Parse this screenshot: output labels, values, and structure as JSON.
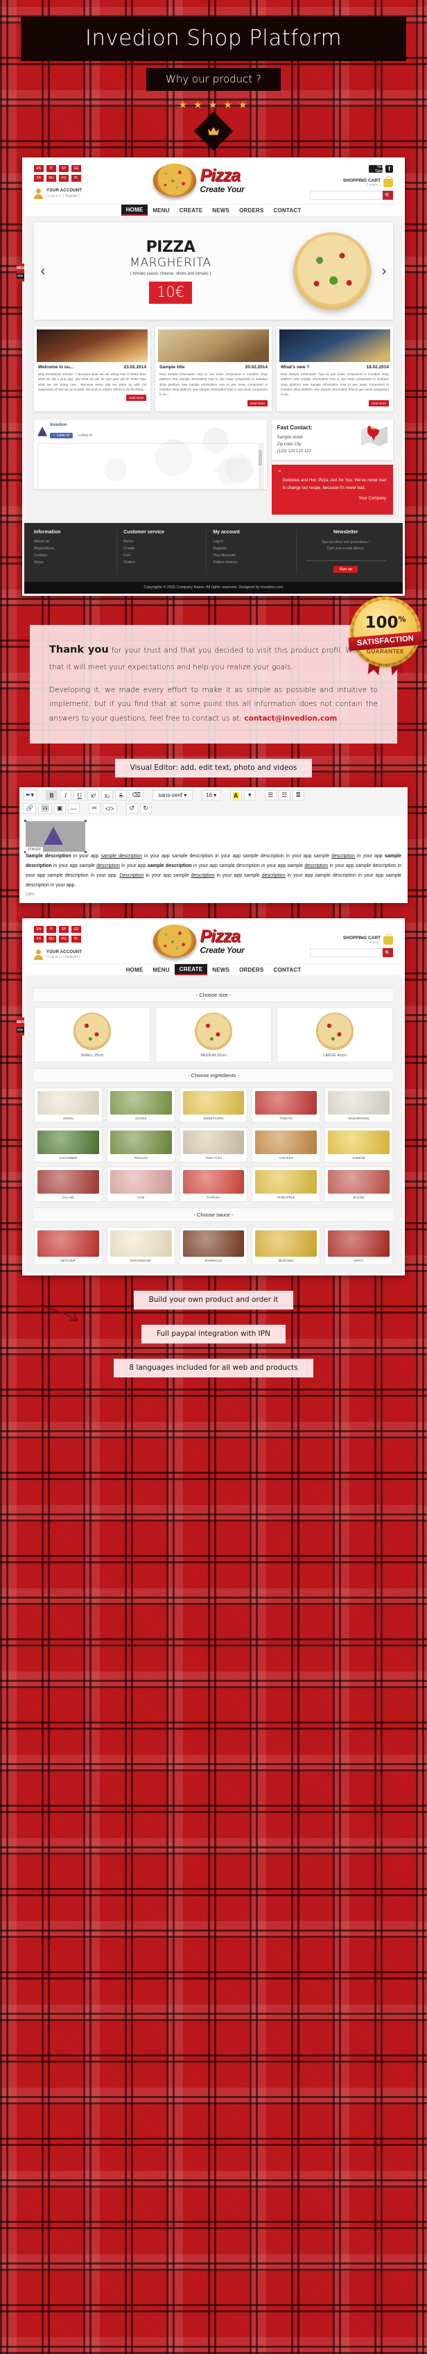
{
  "hero": {
    "title": "Invedion Shop Platform",
    "subtitle": "Why our product ?",
    "stars": "★ ★ ★ ★ ★",
    "badge_icon": "crown-icon"
  },
  "site": {
    "languages": [
      "EN",
      "IT",
      "SP",
      "GE",
      "FR",
      "RU",
      "PO",
      "PL"
    ],
    "account": {
      "label": "YOUR ACCOUNT",
      "links": "( Log in ) / ( Register )"
    },
    "logo": {
      "line1": "Pizza",
      "line2": "Create Your"
    },
    "social": {
      "youtube": "You Tube",
      "facebook": "f"
    },
    "cart": {
      "label": "SHOPPING CART",
      "state": "( empty )"
    },
    "search_placeholder": "",
    "nav": [
      "HOME",
      "MENU",
      "CREATE",
      "NEWS",
      "ORDERS",
      "CONTACT"
    ],
    "nav_active": "HOME",
    "side_tab": {
      "text": "MENU",
      "badge": "PDF"
    },
    "slider": {
      "title": "PIZZA",
      "subtitle": "MARGHERITA",
      "ingredients": "( tomato sauce, cheese, olives and tomato )",
      "price": "10€",
      "prev": "‹",
      "next": "›"
    },
    "news": [
      {
        "title": "Welcome in ou...",
        "date": "23.02.2014",
        "body": "Why INVEDION solution ? Because what we are doing now is better than what we did a year ago, and what we will do next year will be better than what we are doing now... Because every day we wake up with full awareness of why we go to work. We work to inspire others to do the thing...",
        "read_more": "read more"
      },
      {
        "title": "Sample title",
        "date": "20.02.2014",
        "body": "New sample information how to use news component in invedion shop platform new sample information how to use news component in invedion shop platform new sample information how to use news component in invedion shop platform new sample information how to use news component in inv...",
        "read_more": "read more"
      },
      {
        "title": "What's new ?",
        "date": "18.02.2014",
        "body": "New sample information how to use news component in invedion shop platform new sample information how to use news component in invedion shop platform new sample information how to use news component in invedion shop platform new sample information how to use news component in inv...",
        "read_more": "read more"
      }
    ],
    "facebook_widget": {
      "name": "Invedion",
      "like": "Lubię to!",
      "sub": "Lubisz to."
    },
    "fast_contact": {
      "heading": "Fast Contact:",
      "street": "Sample street",
      "city": "Zip code City",
      "phone": "(123) 123 123 123"
    },
    "quote": {
      "mark": "“",
      "text": "Delicious and Hot, Pizza Just for You. We've never had to change our recipe, because it's never bad.",
      "author": "Your Company"
    },
    "footer": {
      "columns": [
        {
          "heading": "Information",
          "links": [
            "About us",
            "Regulations",
            "Contact",
            "News"
          ]
        },
        {
          "heading": "Customer service",
          "links": [
            "Menu",
            "Create",
            "Cart",
            "Orders"
          ]
        },
        {
          "heading": "My account",
          "links": [
            "Log in",
            "Register",
            "Your Account",
            "Orders history"
          ]
        }
      ],
      "newsletter": {
        "heading": "Newsletter",
        "line1": "Special offers and promotions !",
        "line2": "Type your e-mail adress:",
        "button": "Sign up"
      },
      "copyright": "Copyrights © 2015 Company Name. All rights reserved. Designed by invedion.com"
    }
  },
  "thanks": {
    "lead": "Thank you",
    "p1": " for your trust and that you decided to visit this product profil. We hope that it will meet your expectations and help you realize your goals.",
    "p2_a": "Developing it, we made every effort to make it as simple as possible and intuitive to implement, but if you find that at some point this all information does not contain the answers to your questions, feel free to contact us at: ",
    "email": "contact@invedion.com",
    "guarantee": {
      "percent": "100",
      "percent_sign": "%",
      "band": "SATISFACTION",
      "sub": "GUARANTEE"
    }
  },
  "captions": {
    "editor": "Visual Editor: add, edit text, photo and videos",
    "build": "Build your own product and order it",
    "paypal": "Full paypal integration with IPN",
    "languages": "8 languages included for all web and products"
  },
  "editor": {
    "toolbar_row1": [
      {
        "icon": "format-painter-icon",
        "label": "✒▾"
      },
      {
        "icon": "bold-icon",
        "label": "B",
        "active": true
      },
      {
        "icon": "italic-icon",
        "label": "I"
      },
      {
        "icon": "underline-icon",
        "label": "U"
      },
      {
        "icon": "superscript-icon",
        "label": "x²"
      },
      {
        "icon": "subscript-icon",
        "label": "x₂"
      },
      {
        "icon": "strikethrough-icon",
        "label": "S"
      },
      {
        "icon": "clear-format-icon",
        "label": "⌫"
      },
      {
        "icon": "font-family-select",
        "label": "sans-serif ▾"
      },
      {
        "icon": "font-size-select",
        "label": "16 ▾"
      },
      {
        "icon": "text-color-icon",
        "label": "A"
      },
      {
        "icon": "color-dropdown-icon",
        "label": "▾"
      },
      {
        "icon": "unordered-list-icon",
        "label": "☰"
      },
      {
        "icon": "ordered-list-icon",
        "label": "☲"
      },
      {
        "icon": "align-icon",
        "label": "≣"
      }
    ],
    "toolbar_row2": [
      {
        "icon": "link-icon",
        "label": "ὑ7"
      },
      {
        "icon": "image-icon",
        "label": "ὛC"
      },
      {
        "icon": "video-icon",
        "label": "■"
      },
      {
        "icon": "horizontal-rule-icon",
        "label": "—"
      },
      {
        "icon": "cut-icon",
        "label": "✂"
      },
      {
        "icon": "source-code-icon",
        "label": "</>"
      },
      {
        "icon": "undo-icon",
        "label": "↺"
      },
      {
        "icon": "redo-icon",
        "label": "↻"
      }
    ],
    "font_family": "sans-serif",
    "font_size": "16",
    "image_caption": "174x116",
    "image_zoom": "100%",
    "body_text": "Sample description in your app sample description in your app sample description in your app sample description in your app sample description in your app sample description in your app sample description in your app sample description in your app sample description in your app sample description in your app sample description in your app sample description in your app. Description in your app sample description in your app sample description in your app sample description in your app sample description in your app."
  },
  "create": {
    "size_heading": "- Choose size -",
    "sizes": [
      {
        "label": "SMALL 25cm"
      },
      {
        "label": "MEDIUM 32cm"
      },
      {
        "label": "LARGE 45cm"
      }
    ],
    "ingredients_heading": "- Choose ingredients -",
    "ingredients": [
      {
        "name": "ONION",
        "color": "#efe3cf"
      },
      {
        "name": "OLIVES",
        "color": "#7d9b46"
      },
      {
        "name": "SWEETCORN",
        "color": "#e8c44a"
      },
      {
        "name": "TOMATO",
        "color": "#c8342f"
      },
      {
        "name": "MUSHROOMS",
        "color": "#e3dcd0"
      },
      {
        "name": "CUCUMBER",
        "color": "#4e7a32"
      },
      {
        "name": "PICKLES",
        "color": "#6f8f3a"
      },
      {
        "name": "TUNA FISH",
        "color": "#d9c8ad"
      },
      {
        "name": "CHICKEN",
        "color": "#c98a3d"
      },
      {
        "name": "CHEESE",
        "color": "#e9c63c"
      },
      {
        "name": "SALAMI",
        "color": "#a93b33"
      },
      {
        "name": "HAM",
        "color": "#e2a6a2"
      },
      {
        "name": "PAPRIKA",
        "color": "#d8453a"
      },
      {
        "name": "PINEAPPLE",
        "color": "#e3c13f"
      },
      {
        "name": "BACON",
        "color": "#c4564b"
      }
    ],
    "sauce_heading": "- Choose sauce -",
    "sauces": [
      {
        "name": "KETCHUP",
        "color": "#c9302c"
      },
      {
        "name": "MAYONNAISE",
        "color": "#f2e8c8"
      },
      {
        "name": "BARBECUE",
        "color": "#7a3b20"
      },
      {
        "name": "MUSTARD",
        "color": "#e0b230"
      },
      {
        "name": "SPICY",
        "color": "#b32820"
      }
    ]
  },
  "colors": {
    "brand_red": "#cc1b22",
    "dark": "#1c1c1c",
    "gold": "#e8b340"
  }
}
